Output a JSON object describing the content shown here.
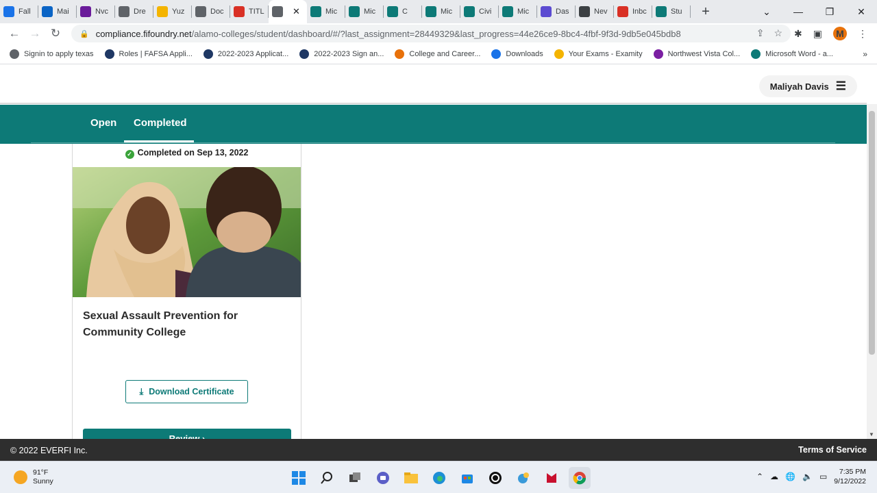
{
  "browser": {
    "tabs": [
      {
        "title": "Fall",
        "color": "#1a73e8"
      },
      {
        "title": "Mai",
        "color": "#0a64c5"
      },
      {
        "title": "Nvc",
        "color": "#6a1b9a"
      },
      {
        "title": "Dre",
        "color": "#5f6368"
      },
      {
        "title": "Yuz",
        "color": "#f4b400"
      },
      {
        "title": "Doc",
        "color": "#5f6368"
      },
      {
        "title": "TITL",
        "color": "#d93025"
      },
      {
        "title": "",
        "color": "#5f6368",
        "active": true
      },
      {
        "title": "Mic",
        "color": "#0d7a77"
      },
      {
        "title": "Mic",
        "color": "#0d7a77"
      },
      {
        "title": "C",
        "color": "#0d7a77"
      },
      {
        "title": "Mic",
        "color": "#0d7a77"
      },
      {
        "title": "Civi",
        "color": "#0d7a77"
      },
      {
        "title": "Mic",
        "color": "#0d7a77"
      },
      {
        "title": "Das",
        "color": "#5b4bd1"
      },
      {
        "title": "Nev",
        "color": "#3c4043"
      },
      {
        "title": "Inbc",
        "color": "#d93025"
      },
      {
        "title": "Stu",
        "color": "#0d7a77"
      }
    ],
    "url_host": "compliance.fifoundry.net",
    "url_path": "/alamo-colleges/student/dashboard/#/?last_assignment=28449329&last_progress=44e26ce9-8bc4-4fbf-9f3d-9db5e045bdb8",
    "profile_initial": "M",
    "bookmarks": [
      {
        "label": "Signin to apply texas",
        "color": "#5f6368"
      },
      {
        "label": "Roles | FAFSA Appli...",
        "color": "#1f3864"
      },
      {
        "label": "2022-2023 Applicat...",
        "color": "#1f3864"
      },
      {
        "label": "2022-2023 Sign an...",
        "color": "#1f3864"
      },
      {
        "label": "College and Career...",
        "color": "#e8710a"
      },
      {
        "label": "Downloads",
        "color": "#1a73e8"
      },
      {
        "label": "Your Exams - Examity",
        "color": "#f4b400"
      },
      {
        "label": "Northwest Vista Col...",
        "color": "#7b1fa2"
      },
      {
        "label": "Microsoft Word - a...",
        "color": "#0d7a77"
      }
    ]
  },
  "page": {
    "user_name": "Maliyah Davis",
    "tabs": {
      "open": "Open",
      "completed": "Completed"
    },
    "card": {
      "completed_text": "Completed on Sep 13, 2022",
      "title": "Sexual Assault Prevention for Community College",
      "download_label": "Download Certificate",
      "review_label": "Review"
    },
    "footer": {
      "copyright": "© 2022 EVERFI Inc.",
      "terms": "Terms of Service"
    }
  },
  "taskbar": {
    "temperature": "91°F",
    "condition": "Sunny",
    "time": "7:35 PM",
    "date": "9/12/2022"
  },
  "colors": {
    "brand_teal": "#0d7a77",
    "footer_bg": "#2e2e2e",
    "check_green": "#3aa33a"
  }
}
